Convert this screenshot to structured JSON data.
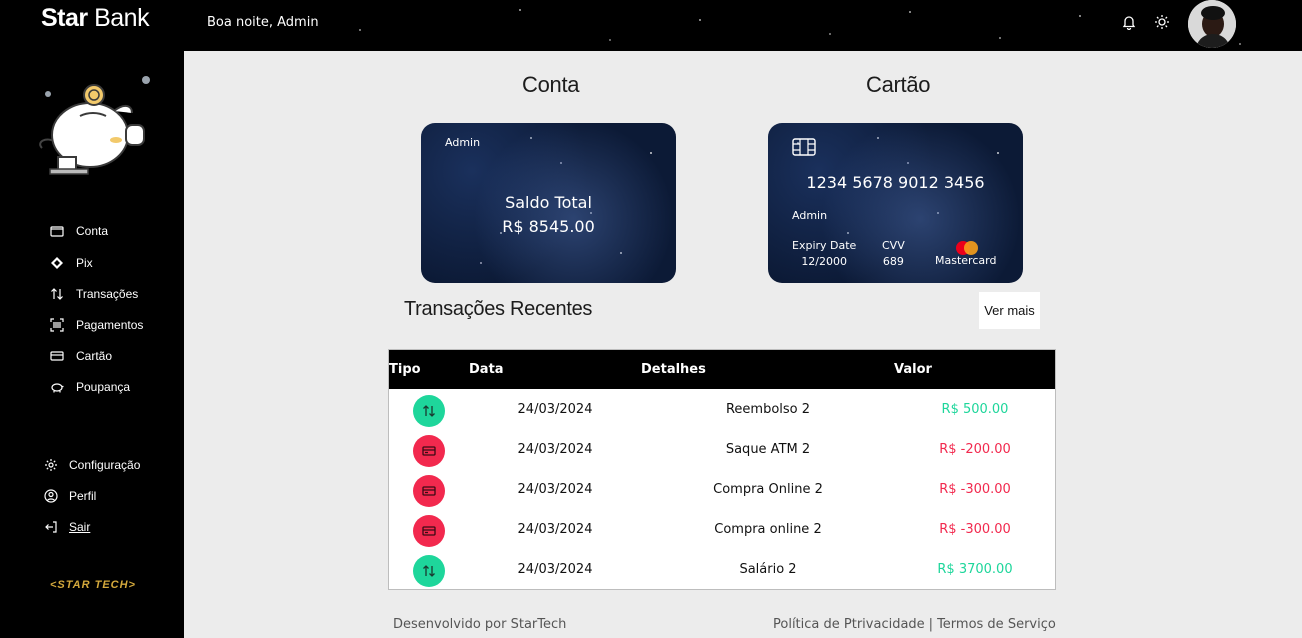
{
  "app": {
    "logo_bold": "Star",
    "logo_rest": " Bank",
    "greeting": "Boa noite, Admin"
  },
  "sidebar": {
    "items": [
      {
        "label": "Conta",
        "icon": "wallet-icon"
      },
      {
        "label": "Pix",
        "icon": "pix-icon"
      },
      {
        "label": "Transações",
        "icon": "transfer-arrows-icon"
      },
      {
        "label": "Pagamentos",
        "icon": "barcode-scan-icon"
      },
      {
        "label": "Cartão",
        "icon": "credit-card-icon"
      },
      {
        "label": "Poupança",
        "icon": "piggy-bank-icon"
      }
    ],
    "settings": [
      {
        "label": "Configuração",
        "icon": "gear-icon"
      },
      {
        "label": "Perfil",
        "icon": "user-circle-icon"
      },
      {
        "label": "Sair",
        "icon": "logout-icon"
      }
    ],
    "brand": "<STAR TECH>"
  },
  "conta": {
    "title": "Conta",
    "holder": "Admin",
    "balance_label": "Saldo Total",
    "balance": "R$ 8545.00"
  },
  "cartao": {
    "title": "Cartão",
    "number": "1234 5678 9012 3456",
    "holder": "Admin",
    "expiry_label": "Expiry Date",
    "expiry": "12/2000",
    "cvv_label": "CVV",
    "cvv": "689",
    "brand": "Mastercard"
  },
  "transactions": {
    "title": "Transações Recentes",
    "more_label": "Ver mais",
    "headers": {
      "tipo": "Tipo",
      "data": "Data",
      "detalhes": "Detalhes",
      "valor": "Valor"
    },
    "rows": [
      {
        "type": "in",
        "date": "24/03/2024",
        "details": "Reembolso 2",
        "value": "R$ 500.00"
      },
      {
        "type": "out",
        "date": "24/03/2024",
        "details": "Saque ATM 2",
        "value": "R$ -200.00"
      },
      {
        "type": "out",
        "date": "24/03/2024",
        "details": "Compra Online 2",
        "value": "R$ -300.00"
      },
      {
        "type": "out",
        "date": "24/03/2024",
        "details": "Compra online 2",
        "value": "R$ -300.00"
      },
      {
        "type": "in",
        "date": "24/03/2024",
        "details": "Salário 2",
        "value": "R$ 3700.00"
      }
    ]
  },
  "footer": {
    "left": "Desenvolvido por StarTech",
    "privacy": "Política de Ptrivacidade",
    "separator": "|",
    "terms": "Termos de Serviço"
  },
  "colors": {
    "positive": "#1ed69b",
    "negative": "#f2294e",
    "accent_gold": "#d4a93c"
  }
}
